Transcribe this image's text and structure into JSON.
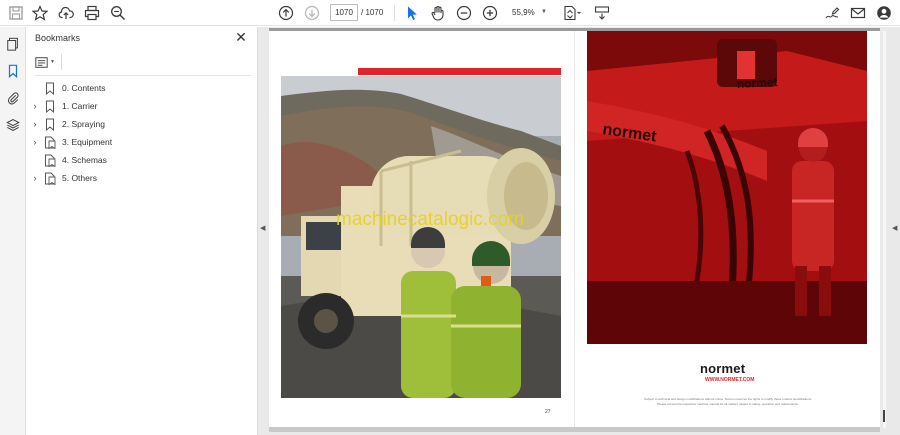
{
  "toolbar": {
    "current_page": "1070",
    "page_separator": "/",
    "total_pages": "1070",
    "zoom": "55,9%"
  },
  "panel": {
    "title": "Bookmarks"
  },
  "bookmarks": [
    {
      "label": "0. Contents",
      "expandable": false,
      "icon": "bookmark-icon"
    },
    {
      "label": "1. Carrier",
      "expandable": true,
      "icon": "bookmark-icon"
    },
    {
      "label": "2. Spraying",
      "expandable": true,
      "icon": "bookmark-icon"
    },
    {
      "label": "3. Equipment",
      "expandable": true,
      "icon": "bookmark-page-icon"
    },
    {
      "label": "4. Schemas",
      "expandable": false,
      "icon": "bookmark-page-icon"
    },
    {
      "label": "5. Others",
      "expandable": true,
      "icon": "bookmark-page-icon"
    }
  ],
  "document": {
    "left_page_number": "27",
    "brand": "normet",
    "brand_url": "WWW.NORMET.COM",
    "fine_print_1": "Subject to technical and design modifications without notice. Normet reserves the rights to modify these product specifications.",
    "fine_print_2": "Please consult the respective machine manual for all matters related to safety, operation and maintenance."
  },
  "watermark": "machinecatalogic.com",
  "colors": {
    "accent_red": "#e2232a",
    "brand_dark": "#1a1a1a",
    "toolbar_icon": "#3a3a3a",
    "selected_tool": "#1473e6"
  }
}
